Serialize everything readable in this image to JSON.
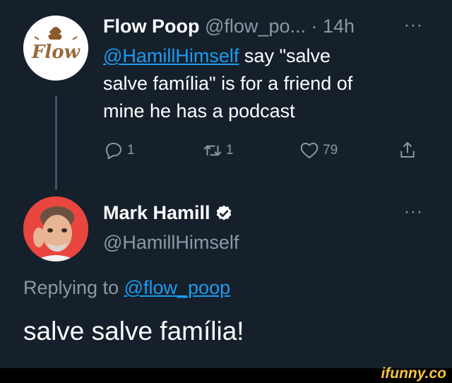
{
  "tweet1": {
    "display_name": "Flow Poop",
    "handle_time": "@flow_po... · 14h",
    "more": "···",
    "avatar_text": "Flow",
    "mention": "@HamillHimself",
    "text_line1_rest": " say \"salve",
    "text_line2": "salve família\" is for a friend of",
    "text_line3": "mine he has a podcast",
    "reply_count": "1",
    "retweet_count": "1",
    "like_count": "79"
  },
  "tweet2": {
    "display_name": "Mark Hamill",
    "handle": "@HamillHimself",
    "more": "···",
    "replying_prefix": "Replying to ",
    "replying_handle": "@flow_poop",
    "text": "salve salve família!"
  },
  "watermark": "ifunny.co",
  "colors": {
    "background": "#15202b",
    "link": "#1d9bf0",
    "muted": "#8b98a5"
  }
}
